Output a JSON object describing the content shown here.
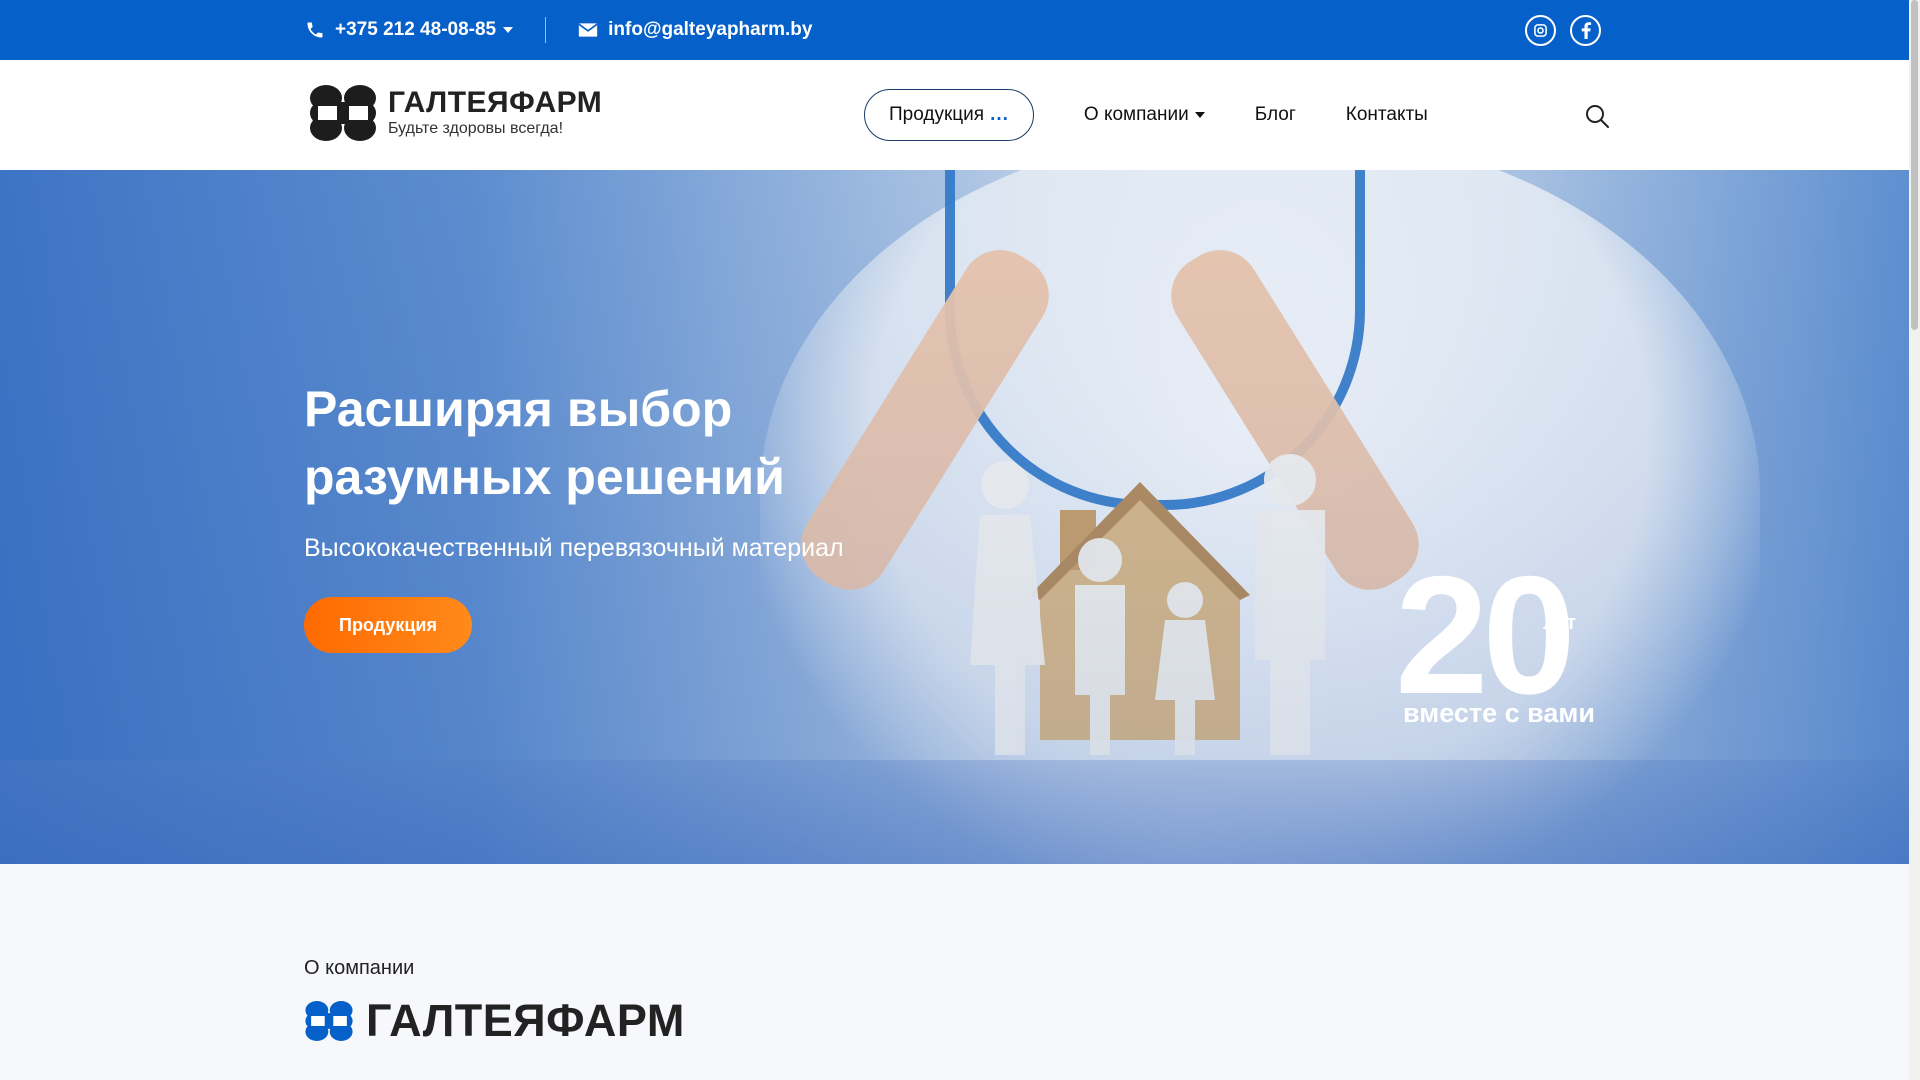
{
  "topbar": {
    "phone": "+375 212 48-08-85",
    "email": "info@galteyapharm.by",
    "social": [
      "instagram-icon",
      "facebook-icon"
    ]
  },
  "header": {
    "logo_name": "ГАЛТЕЯФАРМ",
    "logo_tagline": "Будьте здоровы всегда!",
    "nav": {
      "products": "Продукция",
      "products_dots": "...",
      "about": "О компании",
      "blog": "Блог",
      "contacts": "Контакты"
    }
  },
  "hero": {
    "title": "Расширяя выбор разумных решений",
    "subtitle": "Высококачественный перевязочный материал",
    "button": "Продукция",
    "years_number": "20",
    "years_unit": "лет",
    "years_caption": "вместе с вами"
  },
  "about": {
    "label": "О компании",
    "name": "ГАЛТЕЯФАРМ"
  },
  "colors": {
    "brand_blue": "#0660c9",
    "accent_orange": "#ff6a00"
  }
}
